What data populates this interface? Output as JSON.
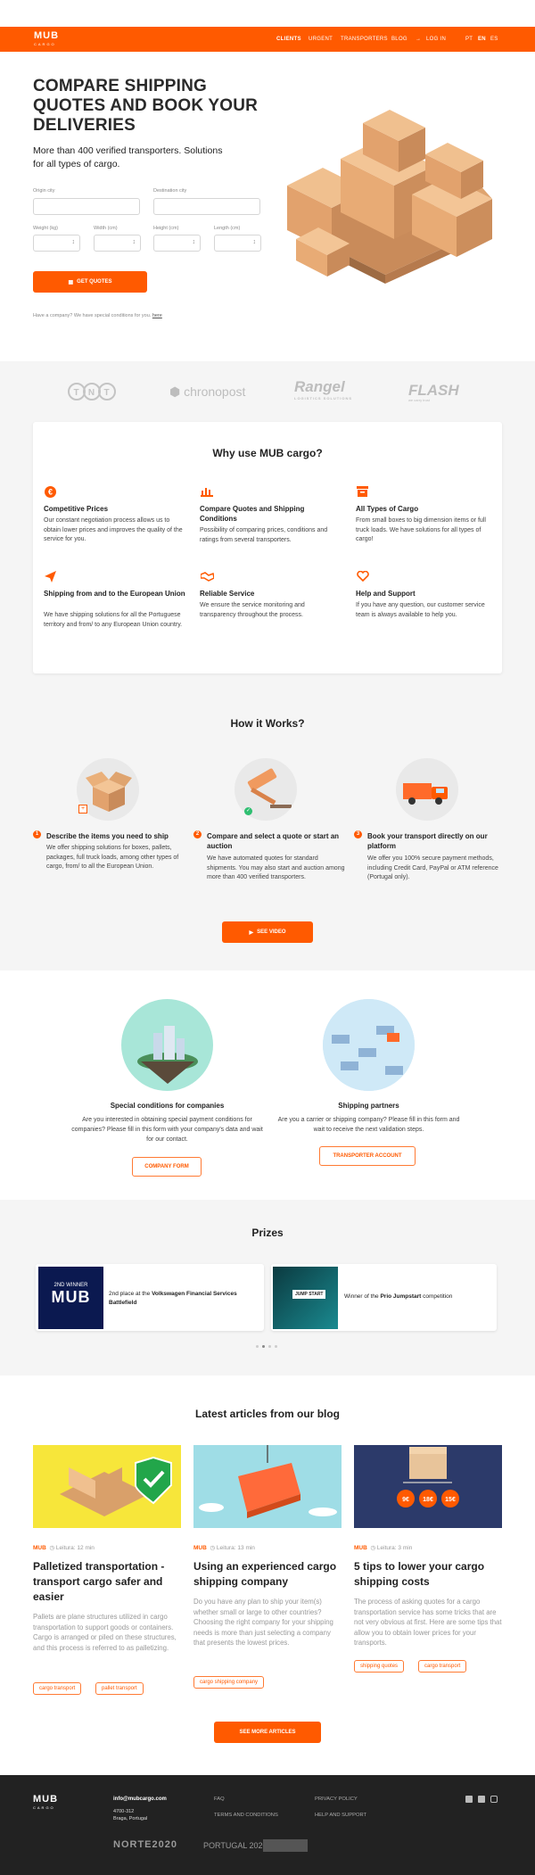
{
  "nav": {
    "logo": "MUB",
    "logo_sub": "CARGO",
    "links": [
      "CLIENTS",
      "URGENT",
      "TRANSPORTERS",
      "BLOG",
      "LOG IN"
    ],
    "langs": [
      "PT",
      "EN",
      "ES"
    ],
    "active_lang": "EN"
  },
  "hero": {
    "title": "COMPARE SHIPPING QUOTES AND BOOK YOUR DELIVERIES",
    "subtitle": "More than 400 verified transporters. Solutions for all types of cargo.",
    "origin_label": "Origin city",
    "destination_label": "Destination city",
    "weight_label": "Weight (kg)",
    "width_label": "Width (cm)",
    "height_label": "Height (cm)",
    "length_label": "Length (cm)",
    "cta": "GET QUOTES",
    "company_note": "Have a company? We have special conditions for you.",
    "company_link": "here"
  },
  "partners": [
    "TNT",
    "chronopost",
    "Rangel",
    "FLASH"
  ],
  "partner_sub": {
    "rangel": "LOGISTICS SOLUTIONS",
    "flash": "we carry trust"
  },
  "why": {
    "title": "Why use MUB cargo?",
    "features": [
      {
        "icon": "euro-icon",
        "title": "Competitive Prices",
        "desc": "Our constant negotiation process allows us to obtain lower prices and improves the quality of the service for you."
      },
      {
        "icon": "bar-chart-icon",
        "title": "Compare Quotes and Shipping Conditions",
        "desc": "Possibility of comparing prices, conditions and ratings from several transporters."
      },
      {
        "icon": "box-icon",
        "title": "All Types of Cargo",
        "desc": "From small boxes to big dimension items or full truck loads. We have solutions for all types of cargo!"
      },
      {
        "icon": "paper-plane-icon",
        "title": "Shipping from and to the European Union",
        "desc": "We have shipping solutions for all the Portuguese territory and from/ to any European Union country."
      },
      {
        "icon": "handshake-icon",
        "title": "Reliable Service",
        "desc": "We ensure the service monitoring and transparency throughout the process."
      },
      {
        "icon": "heart-icon",
        "title": "Help and Support",
        "desc": "If you have any question, our customer service team is always available to help you."
      }
    ]
  },
  "how": {
    "title": "How it Works?",
    "steps": [
      {
        "n": "1",
        "title": "Describe the items you need to ship",
        "desc": "We offer shipping solutions for boxes, pallets, packages, full truck loads, among other types of cargo, from/ to all the European Union."
      },
      {
        "n": "2",
        "title": "Compare and select a quote or start an auction",
        "desc": "We have automated quotes for standard shipments. You may also start and auction among more than 400 verified transporters."
      },
      {
        "n": "3",
        "title": "Book your transport directly on our platform",
        "desc": "We offer you 100% secure payment methods, including Credit Card, PayPal or ATM reference (Portugal only)."
      }
    ],
    "video_btn": "SEE VIDEO"
  },
  "special": {
    "companies_title": "Special conditions for companies",
    "companies_desc": "Are you interested in obtaining special payment conditions for companies? Please fill in this form with your company's data and wait for our contact.",
    "companies_btn": "COMPANY FORM",
    "partners_title": "Shipping partners",
    "partners_desc": "Are you a carrier or shipping company? Please fill in this form and wait to receive the next validation steps.",
    "partners_btn": "TRANSPORTER ACCOUNT"
  },
  "prizes": {
    "title": "Prizes",
    "items": [
      {
        "badge": "2ND WINNER",
        "logo": "MUB",
        "pre": "2nd place at the ",
        "bold": "Volkswagen Financial Services Battlefield",
        "post": ""
      },
      {
        "badge": "JUMP START",
        "pre": "Winner of the ",
        "bold": "Prio Jumpstart",
        "post": " competition"
      }
    ]
  },
  "blog": {
    "title": "Latest articles from our blog",
    "posts": [
      {
        "brand": "MUB",
        "read": "Leitura: 12 min",
        "title": "Palletized transportation - transport cargo safer and easier",
        "desc": "Pallets are plane structures utilized in cargo transportation to support goods or containers. Cargo is arranged or piled on these structures, and this process is referred to as palletizing.",
        "tags": [
          "cargo transport",
          "pallet transport"
        ]
      },
      {
        "brand": "MUB",
        "read": "Leitura: 13 min",
        "title": "Using an experienced cargo shipping company",
        "desc": "Do you have any plan to ship your item(s) whether small or large to other countries? Choosing the right company for your shipping needs is more than just selecting a company that presents the lowest prices.",
        "tags": [
          "cargo shipping company"
        ]
      },
      {
        "brand": "MUB",
        "read": "Leitura: 3 min",
        "title": "5 tips to lower your cargo shipping costs",
        "desc": "The process of asking quotes for a cargo transportation service has some tricks that are not very obvious at first. Here are some tips that allow you to obtain lower prices for your transports.",
        "tags": [
          "shipping quotes",
          "cargo transport"
        ],
        "prices": [
          "9€",
          "18€",
          "15€"
        ]
      }
    ],
    "more_btn": "SEE MORE ARTICLES"
  },
  "footer": {
    "email": "info@mubcargo.com",
    "address1": "4700-312",
    "address2": "Braga, Portugal",
    "links": [
      "FAQ",
      "PRIVACY POLICY",
      "TERMS AND CONDITIONS",
      "HELP AND SUPPORT"
    ],
    "sponsors": [
      "NORTE2020",
      "PORTUGAL 2020"
    ]
  },
  "colors": {
    "accent": "#ff5a00",
    "footer": "#222222",
    "grey_bg": "#f5f5f5"
  }
}
